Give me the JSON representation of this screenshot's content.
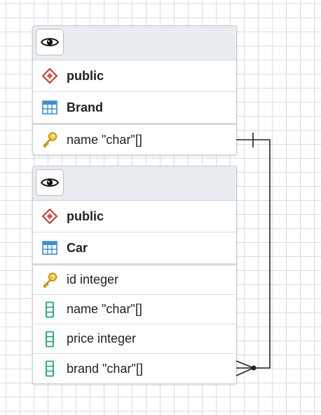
{
  "tables": [
    {
      "schema": "public",
      "name": "Brand",
      "columns": [
        {
          "label": "name \"char\"[]",
          "icon": "key-icon"
        }
      ]
    },
    {
      "schema": "public",
      "name": "Car",
      "columns": [
        {
          "label": "id integer",
          "icon": "key-icon"
        },
        {
          "label": "name \"char\"[]",
          "icon": "column-icon"
        },
        {
          "label": "price integer",
          "icon": "column-icon"
        },
        {
          "label": "brand \"char\"[]",
          "icon": "column-icon"
        }
      ]
    }
  ],
  "colors": {
    "schema_icon": "#c0392b",
    "table_icon": "#3b8fd6",
    "key_icon": "#e0b21c",
    "column_icon": "#1aa37a",
    "edge": "#222222"
  }
}
